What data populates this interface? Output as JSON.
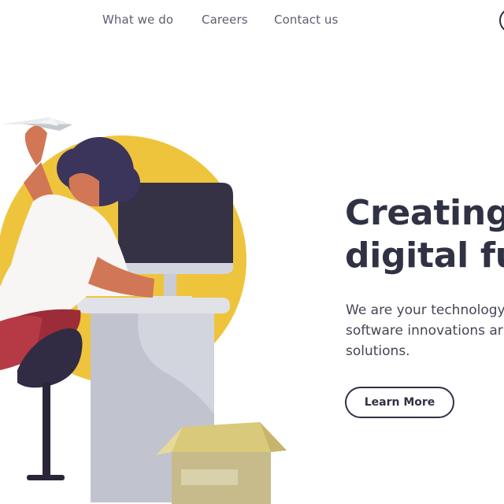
{
  "nav": {
    "items": [
      {
        "label": "What we do"
      },
      {
        "label": "Careers"
      },
      {
        "label": "Contact us"
      }
    ]
  },
  "hero": {
    "title_lines": [
      "Creating",
      "digital fu"
    ],
    "description_lines": [
      "We are your technology",
      "software innovations ar",
      "solutions."
    ],
    "cta_label": "Learn More"
  },
  "colors": {
    "text_dark": "#303244",
    "nav_text": "#5b5e72",
    "accent_yellow": "#efc43d",
    "monitor_dark": "#353246",
    "desk_gray": "#d3d5de"
  },
  "icons": {
    "nav_circle": "circle-icon",
    "paper_plane": "paper-plane-icon",
    "computer_monitor": "computer-monitor-icon",
    "desk": "desk-icon",
    "cardboard_box": "cardboard-box-icon",
    "chair": "chair-icon"
  }
}
